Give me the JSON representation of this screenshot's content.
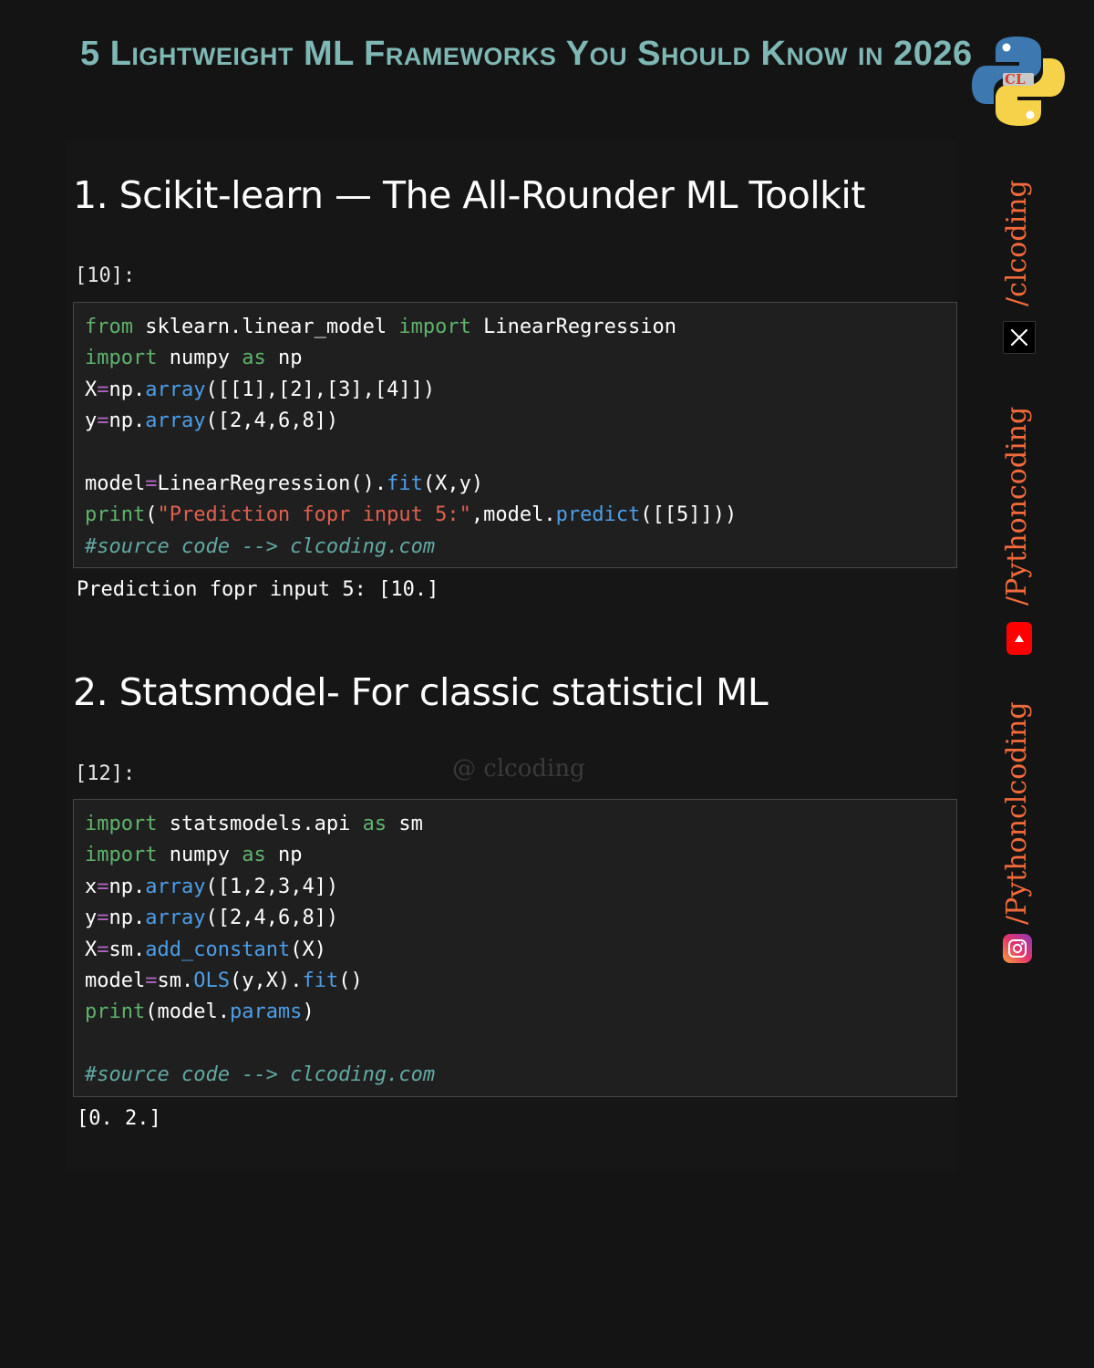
{
  "header": {
    "title": "5 Lightweight ML Frameworks You Should Know in 2026"
  },
  "sections": [
    {
      "heading": "1. Scikit-learn — The All-Rounder ML Toolkit",
      "prompt": "[10]:",
      "output": "Prediction fopr input 5: [10.]"
    },
    {
      "heading": "2. Statsmodel- For classic statisticl ML",
      "prompt": "[12]:",
      "output": "[0. 2.]"
    }
  ],
  "code1": {
    "l1": {
      "k1": "from",
      "m": " sklearn.linear_model ",
      "k2": "import",
      "n": " LinearRegression"
    },
    "l2": {
      "k1": "import",
      "m": " numpy ",
      "k2": "as",
      "n": " np"
    },
    "l3": {
      "a": "X",
      "eq": "=",
      "b": "np.",
      "f": "array",
      "r": "([[1],[2],[3],[4]])"
    },
    "l4": {
      "a": "y",
      "eq": "=",
      "b": "np.",
      "f": "array",
      "r": "([2,4,6,8])"
    },
    "l6": {
      "a": "model",
      "eq": "=",
      "b": "LinearRegression().",
      "f": "fit",
      "r": "(X,y)"
    },
    "l7": {
      "p": "print",
      "o": "(",
      "s": "\"Prediction fopr input 5:\"",
      "m": ",model.",
      "f": "predict",
      "r": "([[5]]))"
    },
    "l8": "#source code --> clcoding.com"
  },
  "code2": {
    "l1": {
      "k1": "import",
      "m": " statsmodels.api ",
      "k2": "as",
      "n": " sm"
    },
    "l2": {
      "k1": "import",
      "m": " numpy ",
      "k2": "as",
      "n": " np"
    },
    "l3": {
      "a": "x",
      "eq": "=",
      "b": "np.",
      "f": "array",
      "r": "([1,2,3,4])"
    },
    "l4": {
      "a": "y",
      "eq": "=",
      "b": "np.",
      "f": "array",
      "r": "([2,4,6,8])"
    },
    "l5": {
      "a": "X",
      "eq": "=",
      "b": "sm.",
      "f": "add_constant",
      "r": "(X)"
    },
    "l6": {
      "a": "model",
      "eq": "=",
      "b": "sm.",
      "f": "OLS",
      "m": "(y,X).",
      "f2": "fit",
      "r": "()"
    },
    "l7": {
      "p": "print",
      "m": "(model.",
      "f": "params",
      "r": ")"
    },
    "l9": "#source code --> clcoding.com"
  },
  "watermark": "@ clcoding",
  "social": {
    "x_handle": "/clcoding",
    "youtube_handle": "/Pythoncoding",
    "instagram_handle": "/Pythonclcoding"
  },
  "colors": {
    "title": "#7fb7b4",
    "keyword": "#5fb36c",
    "function": "#4d9ee8",
    "string": "#e06050",
    "comment": "#62a9a3",
    "social": "#f26a3c"
  },
  "icons": [
    "python-logo-icon",
    "x-logo-icon",
    "youtube-icon",
    "instagram-icon"
  ]
}
